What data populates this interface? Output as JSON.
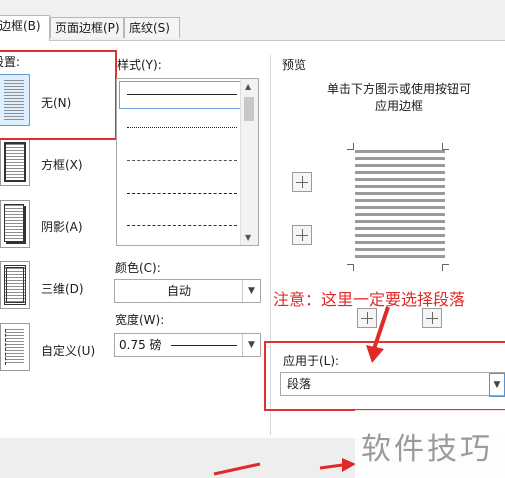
{
  "tabs": [
    {
      "label": "边框(B)"
    },
    {
      "label": "页面边框(P)"
    },
    {
      "label": "底纹(S)"
    }
  ],
  "settings": {
    "title": "设置:",
    "items": [
      {
        "label": "无(N)"
      },
      {
        "label": "方框(X)"
      },
      {
        "label": "阴影(A)"
      },
      {
        "label": "三维(D)"
      },
      {
        "label": "自定义(U)"
      }
    ]
  },
  "style": {
    "title": "样式(Y):"
  },
  "color": {
    "title": "颜色(C):",
    "value": "自动"
  },
  "width": {
    "title": "宽度(W):",
    "value": "0.75 磅"
  },
  "preview": {
    "title": "预览",
    "hint_line1": "单击下方图示或使用按钮可",
    "hint_line2": "应用边框"
  },
  "apply_to": {
    "title": "应用于(L):",
    "value": "段落"
  },
  "annotation": "注意：这里一定要选择段落",
  "watermark": "软件技巧",
  "colors": {
    "accent_red": "#e03030",
    "selection_blue": "#6c9ed8"
  }
}
